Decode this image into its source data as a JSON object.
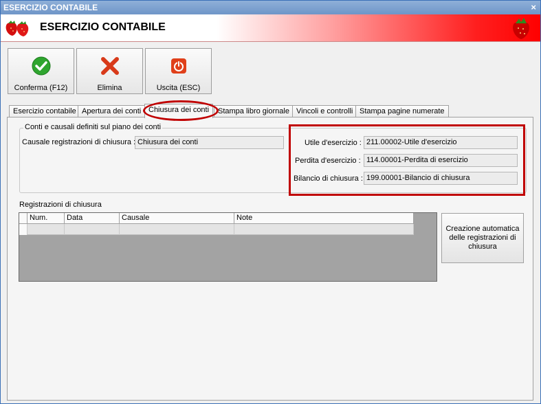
{
  "window": {
    "title": "ESERCIZIO CONTABILE",
    "close_glyph": "×",
    "header_title": "ESERCIZIO CONTABILE",
    "brand_color": "#ff0000"
  },
  "toolbar": {
    "confirm_label": "Conferma (F12)",
    "delete_label": "Elimina",
    "exit_label": "Uscita (ESC)",
    "confirm_icon": "check-circle-icon",
    "delete_icon": "red-x-icon",
    "exit_icon": "power-icon"
  },
  "tabs": [
    {
      "label": "Esercizio contabile"
    },
    {
      "label": "Apertura dei conti"
    },
    {
      "label": "Chiusura dei conti",
      "active": true
    },
    {
      "label": "Stampa libro giornale"
    },
    {
      "label": "Vincoli e controlli"
    },
    {
      "label": "Stampa pagine numerate"
    }
  ],
  "group": {
    "legend": "Conti e causali definiti sul piano dei conti",
    "causale_label": "Causale registrazioni di chiusura :",
    "causale_value": "Chiusura dei conti",
    "utile_label": "Utile d'esercizio :",
    "utile_value": "211.00002-Utile d'esercizio",
    "perdita_label": "Perdita d'esercizio :",
    "perdita_value": "114.00001-Perdita di esercizio",
    "bilancio_label": "Bilancio di chiusura :",
    "bilancio_value": "199.00001-Bilancio di chiusura"
  },
  "registrazioni": {
    "title": "Registrazioni di chiusura",
    "columns": [
      "Num.",
      "Data",
      "Causale",
      "Note"
    ],
    "create_button_label": "Creazione automatica delle registrazioni di chiusura"
  }
}
